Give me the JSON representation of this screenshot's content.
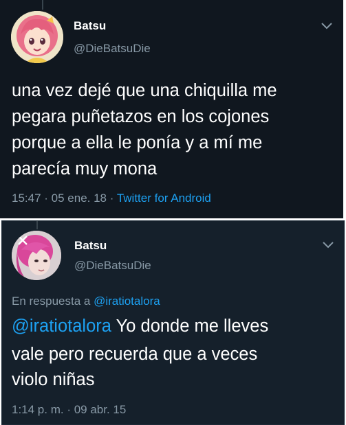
{
  "tweet1": {
    "display_name": "Batsu",
    "handle": "@DieBatsuDie",
    "text_lines": [
      "una vez dejé que una chiquilla me",
      "pegara puñetazos en los cojones",
      "porque a ella le ponía y a mí me",
      "parecía muy mona"
    ],
    "time": "15:47",
    "date": "05 ene. 18",
    "separator": " · ",
    "source": "Twitter for Android",
    "avatar_icon": "anime-girl-avatar",
    "menu_icon": "chevron-down-icon"
  },
  "tweet2": {
    "display_name": "Batsu",
    "handle": "@DieBatsuDie",
    "reply_prefix": "En respuesta a ",
    "reply_to": "@iratiotalora",
    "mention": "@iratiotalora",
    "text_line1_rest": " Yo donde me lleves",
    "text_lines": [
      "vale pero recuerda que a veces",
      "violo niñas"
    ],
    "time": "1:14 p. m.",
    "date": "09 abr. 15",
    "separator": " · ",
    "avatar_icon": "pink-hair-photo-avatar",
    "menu_icon": "chevron-down-icon"
  },
  "colors": {
    "background_dark": "#10171f",
    "background_dim": "#15202b",
    "text": "#ffffff",
    "secondary_text": "#8899a6",
    "link": "#1da1f2"
  }
}
